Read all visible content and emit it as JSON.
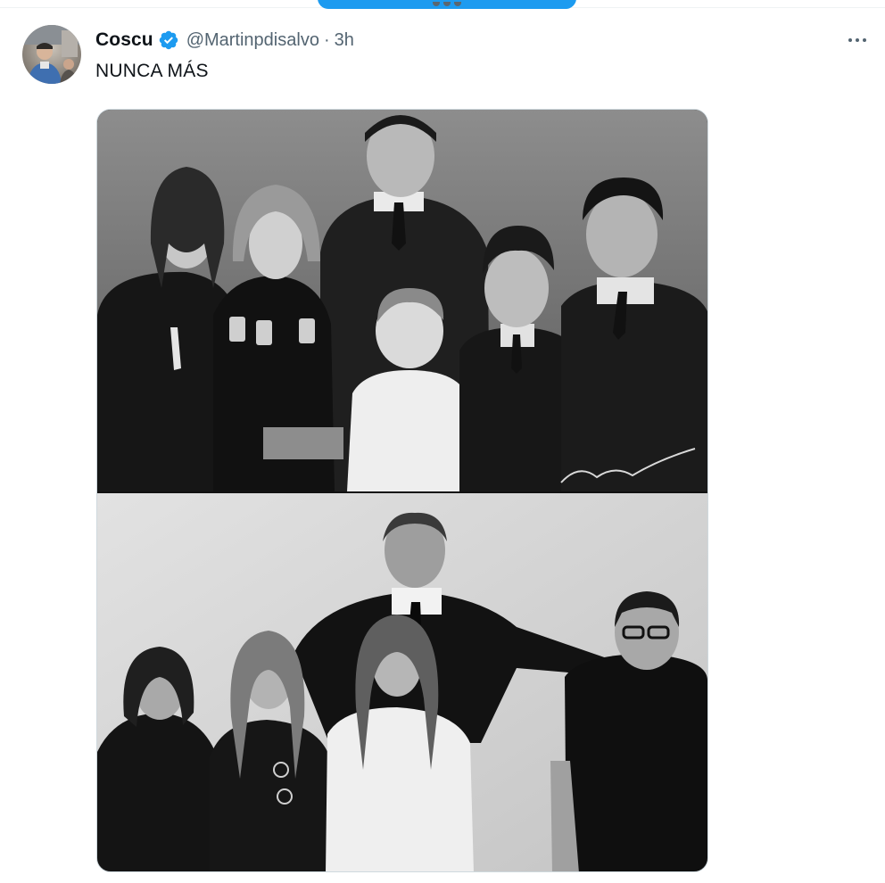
{
  "tweet": {
    "author_name": "Coscu",
    "handle": "@Martinpdisalvo",
    "separator": "·",
    "time": "3h",
    "text": "NUNCA MÁS"
  },
  "icons": {
    "verified": "verified-badge-icon",
    "more": "more-options-icon"
  },
  "media": {
    "photos": [
      {
        "name": "vintage-family-photo",
        "style": "black-and-white"
      },
      {
        "name": "recent-family-photo",
        "style": "black-and-white"
      }
    ]
  },
  "colors": {
    "accent": "#1d9bf0",
    "text_primary": "#0f1419",
    "text_secondary": "#536471",
    "border": "#cfd9de"
  }
}
